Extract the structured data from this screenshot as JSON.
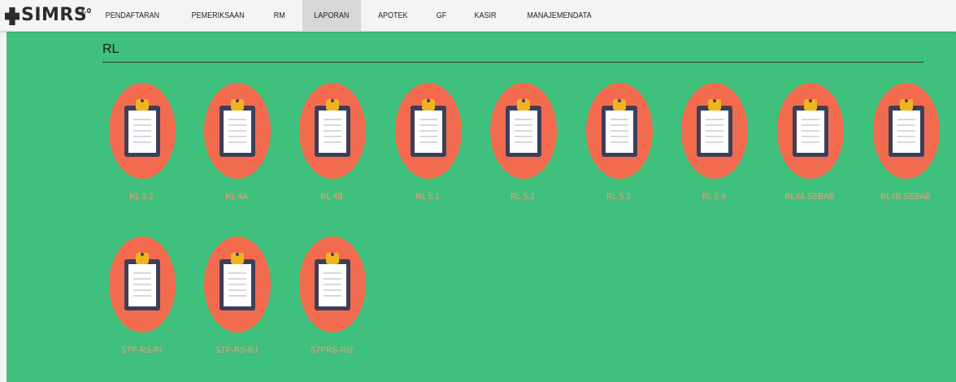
{
  "app": {
    "logo_text": "SIMRS",
    "logo_version": "3.0"
  },
  "nav": {
    "items": [
      {
        "label": "PENDAFTARAN",
        "active": false
      },
      {
        "label": "PEMERIKSAAN",
        "active": false
      },
      {
        "label": "RM",
        "active": false
      },
      {
        "label": "LAPORAN",
        "active": true
      },
      {
        "label": "APOTEK",
        "active": false
      },
      {
        "label": "GF",
        "active": false
      },
      {
        "label": "KASIR",
        "active": false
      },
      {
        "label": "MANAJEMENDATA",
        "active": false
      }
    ]
  },
  "section": {
    "title": "RL"
  },
  "reports": [
    {
      "label": "RL 3.2",
      "icon": "clipboard-icon"
    },
    {
      "label": "RL 4A",
      "icon": "clipboard-icon"
    },
    {
      "label": "RL 4B",
      "icon": "clipboard-icon"
    },
    {
      "label": "RL 5.1",
      "icon": "clipboard-icon"
    },
    {
      "label": "RL 5.2",
      "icon": "clipboard-icon"
    },
    {
      "label": "RL 5.3",
      "icon": "clipboard-icon"
    },
    {
      "label": "RL 5.4",
      "icon": "clipboard-icon"
    },
    {
      "label": "RL4A SEBAB",
      "icon": "clipboard-icon"
    },
    {
      "label": "RL4B SEBAB",
      "icon": "clipboard-icon"
    },
    {
      "label": "STP-RS-RI",
      "icon": "clipboard-icon"
    },
    {
      "label": "STP-RS-RJ",
      "icon": "clipboard-icon"
    },
    {
      "label": "STPRS-RI2",
      "icon": "clipboard-icon"
    }
  ],
  "colors": {
    "background": "#3fc07c",
    "icon_circle": "#f36b4f",
    "clipboard_frame": "#3d3f58",
    "clip": "#f2b41e",
    "label": "#f29a7a"
  }
}
